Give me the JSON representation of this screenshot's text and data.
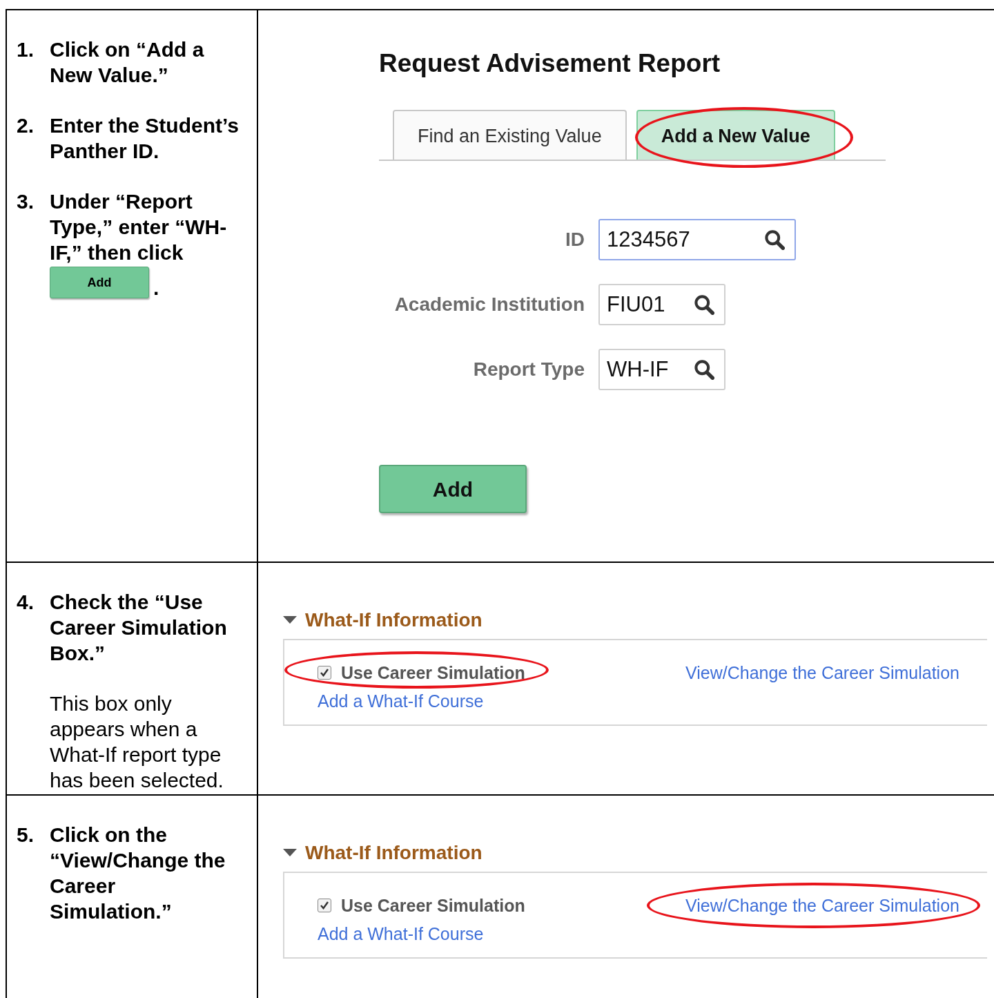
{
  "rows": [
    {
      "steps": [
        {
          "number": "1.",
          "text": "Click on “Add a New Value.”"
        },
        {
          "number": "2.",
          "text": "Enter the Student’s Panther ID."
        },
        {
          "number": "3.",
          "text": "Under “Report Type,” enter “WH-IF,” then click",
          "button": "Add",
          "after": "."
        }
      ],
      "panel": {
        "kind": "search_page",
        "title": "Request Advisement Report",
        "tabs": [
          {
            "label": "Find an Existing Value",
            "selected": false,
            "circled": false
          },
          {
            "label": "Add a New Value",
            "selected": true,
            "circled": true
          }
        ],
        "fields": [
          {
            "label": "ID",
            "value": "1234567",
            "focused": true
          },
          {
            "label": "Academic Institution",
            "value": "FIU01",
            "focused": false
          },
          {
            "label": "Report Type",
            "value": "WH-IF",
            "focused": false
          }
        ],
        "button": "Add"
      }
    },
    {
      "steps": [
        {
          "number": "4.",
          "text": "Check the “Use Career Simulation Box.”"
        }
      ],
      "note": "This box only appears when a What-If report type has been selected.",
      "panel": {
        "kind": "what_if",
        "heading": "What-If Information",
        "expanded": true,
        "checkbox": {
          "label": "Use Career Simulation",
          "checked": true,
          "circled": true
        },
        "course_link": "Add a What-If Course",
        "simulation_link": {
          "label": "View/Change the Career Simulation",
          "circled": false
        }
      }
    },
    {
      "steps": [
        {
          "number": "5.",
          "text": "Click on the “View/Change the Career Simulation.”"
        }
      ],
      "panel": {
        "kind": "what_if",
        "heading": "What-If Information",
        "expanded": true,
        "checkbox": {
          "label": "Use Career Simulation",
          "checked": true,
          "circled": false
        },
        "course_link": "Add a What-If Course",
        "simulation_link": {
          "label": "View/Change the Career Simulation",
          "circled": true
        }
      }
    }
  ]
}
